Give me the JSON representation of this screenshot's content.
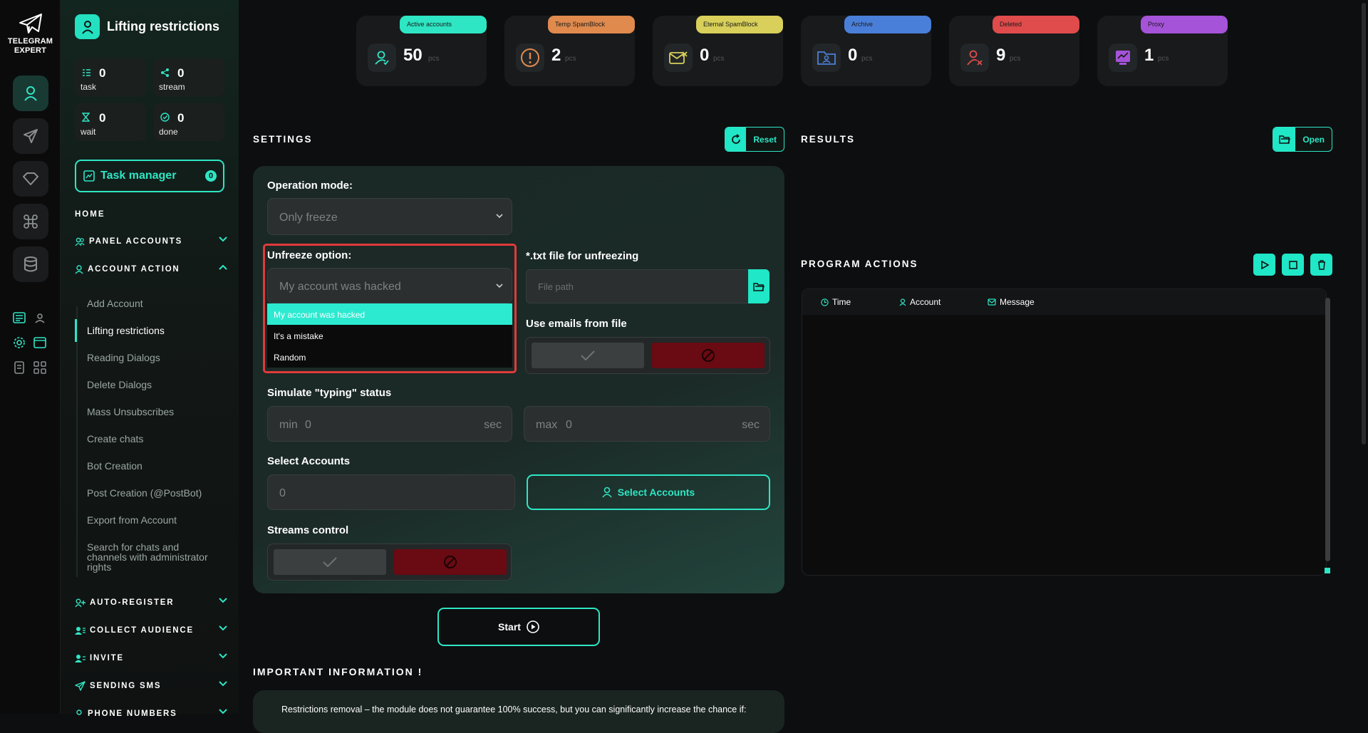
{
  "app": {
    "logo_line1": "TELEGRAM",
    "logo_line2": "EXPERT"
  },
  "sidebar": {
    "title": "Lifting restrictions",
    "stats": [
      {
        "value": "0",
        "label": "task"
      },
      {
        "value": "0",
        "label": "stream"
      },
      {
        "value": "0",
        "label": "wait"
      },
      {
        "value": "0",
        "label": "done"
      }
    ],
    "task_manager": {
      "label": "Task manager",
      "count": "0"
    },
    "home": "HOME",
    "sections": [
      {
        "label": "PANEL ACCOUNTS"
      },
      {
        "label": "ACCOUNT ACTION"
      },
      {
        "label": "AUTO-REGISTER"
      },
      {
        "label": "COLLECT AUDIENCE"
      },
      {
        "label": "INVITE"
      },
      {
        "label": "SENDING SMS"
      },
      {
        "label": "PHONE NUMBERS"
      }
    ],
    "sub_items": [
      "Add Account",
      "Lifting restrictions",
      "Reading Dialogs",
      "Delete Dialogs",
      "Mass Unsubscribes",
      "Create chats",
      "Bot Creation",
      "Post Creation (@PostBot)",
      "Export from Account",
      "Search for chats and channels with administrator rights"
    ]
  },
  "cards": [
    {
      "label": "Active accounts",
      "value": "50",
      "unit": "pcs",
      "color": "#2ee6c4"
    },
    {
      "label": "Temp SpamBlock",
      "value": "2",
      "unit": "pcs",
      "color": "#e08a4e"
    },
    {
      "label": "Eternal SpamBlock",
      "value": "0",
      "unit": "pcs",
      "color": "#d8d05a"
    },
    {
      "label": "Archive",
      "value": "0",
      "unit": "pcs",
      "color": "#4a7fd9"
    },
    {
      "label": "Deleted",
      "value": "9",
      "unit": "pcs",
      "color": "#e04b4b"
    },
    {
      "label": "Proxy",
      "value": "1",
      "unit": "pcs",
      "color": "#a553d9"
    }
  ],
  "settings": {
    "header": "SETTINGS",
    "reset": "Reset",
    "operation_mode_label": "Operation mode:",
    "operation_mode_value": "Only freeze",
    "unfreeze_label": "Unfreeze option:",
    "unfreeze_value": "My account was hacked",
    "unfreeze_options": [
      "My account was hacked",
      "It's a mistake",
      "Random"
    ],
    "txt_label": "*.txt file for unfreezing",
    "txt_placeholder": "File path",
    "emails_label": "Use emails from file",
    "typing_label": "Simulate \"typing\" status",
    "min_prefix": "min",
    "min_value": "0",
    "max_prefix": "max",
    "max_value": "0",
    "sec_unit": "sec",
    "select_label": "Select Accounts",
    "select_value": "0",
    "select_button": "Select Accounts",
    "streams_label": "Streams control",
    "start": "Start"
  },
  "results": {
    "header": "RESULTS",
    "open": "Open"
  },
  "program_actions": {
    "header": "PROGRAM ACTIONS",
    "columns": [
      "Time",
      "Account",
      "Message"
    ]
  },
  "important": {
    "header": "IMPORTANT INFORMATION !",
    "text": "Restrictions removal – the module does not guarantee 100% success, but you can significantly increase the chance if:"
  },
  "colors": {
    "accent": "#2ee6c4",
    "danger": "#6a0a12",
    "highlight": "#e03a3a"
  }
}
